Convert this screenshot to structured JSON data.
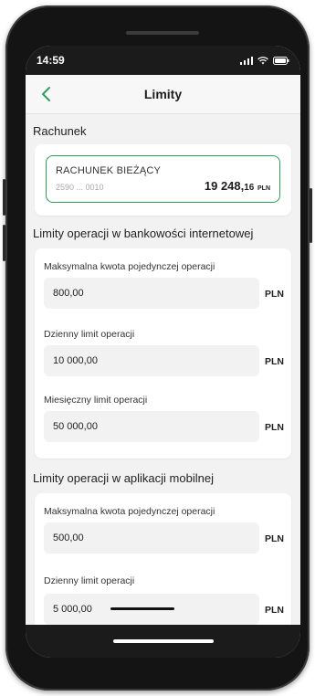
{
  "status_bar": {
    "time": "14:59"
  },
  "header": {
    "title": "Limity"
  },
  "account_section": {
    "label": "Rachunek",
    "account": {
      "name": "RACHUNEK BIEŻĄCY",
      "number": "2590 ... 0010",
      "balance_int": "19 248,",
      "balance_dec": "16",
      "currency": "PLN"
    }
  },
  "internet_limits": {
    "title": "Limity operacji w bankowości internetowej",
    "fields": [
      {
        "label": "Maksymalna kwota pojedynczej operacji",
        "value": "800,00",
        "currency": "PLN"
      },
      {
        "label": "Dzienny limit operacji",
        "value": "10 000,00",
        "currency": "PLN"
      },
      {
        "label": "Miesięczny limit operacji",
        "value": "50 000,00",
        "currency": "PLN"
      }
    ]
  },
  "mobile_limits": {
    "title": "Limity operacji w aplikacji mobilnej",
    "fields": [
      {
        "label": "Maksymalna kwota pojedynczej operacji",
        "value": "500,00",
        "currency": "PLN"
      },
      {
        "label": "Dzienny limit operacji",
        "value": "5 000,00",
        "currency": "PLN"
      }
    ]
  },
  "colors": {
    "accent_green": "#2e9e5b",
    "screen_bg": "#f2f2f2",
    "bezel": "#141414"
  }
}
